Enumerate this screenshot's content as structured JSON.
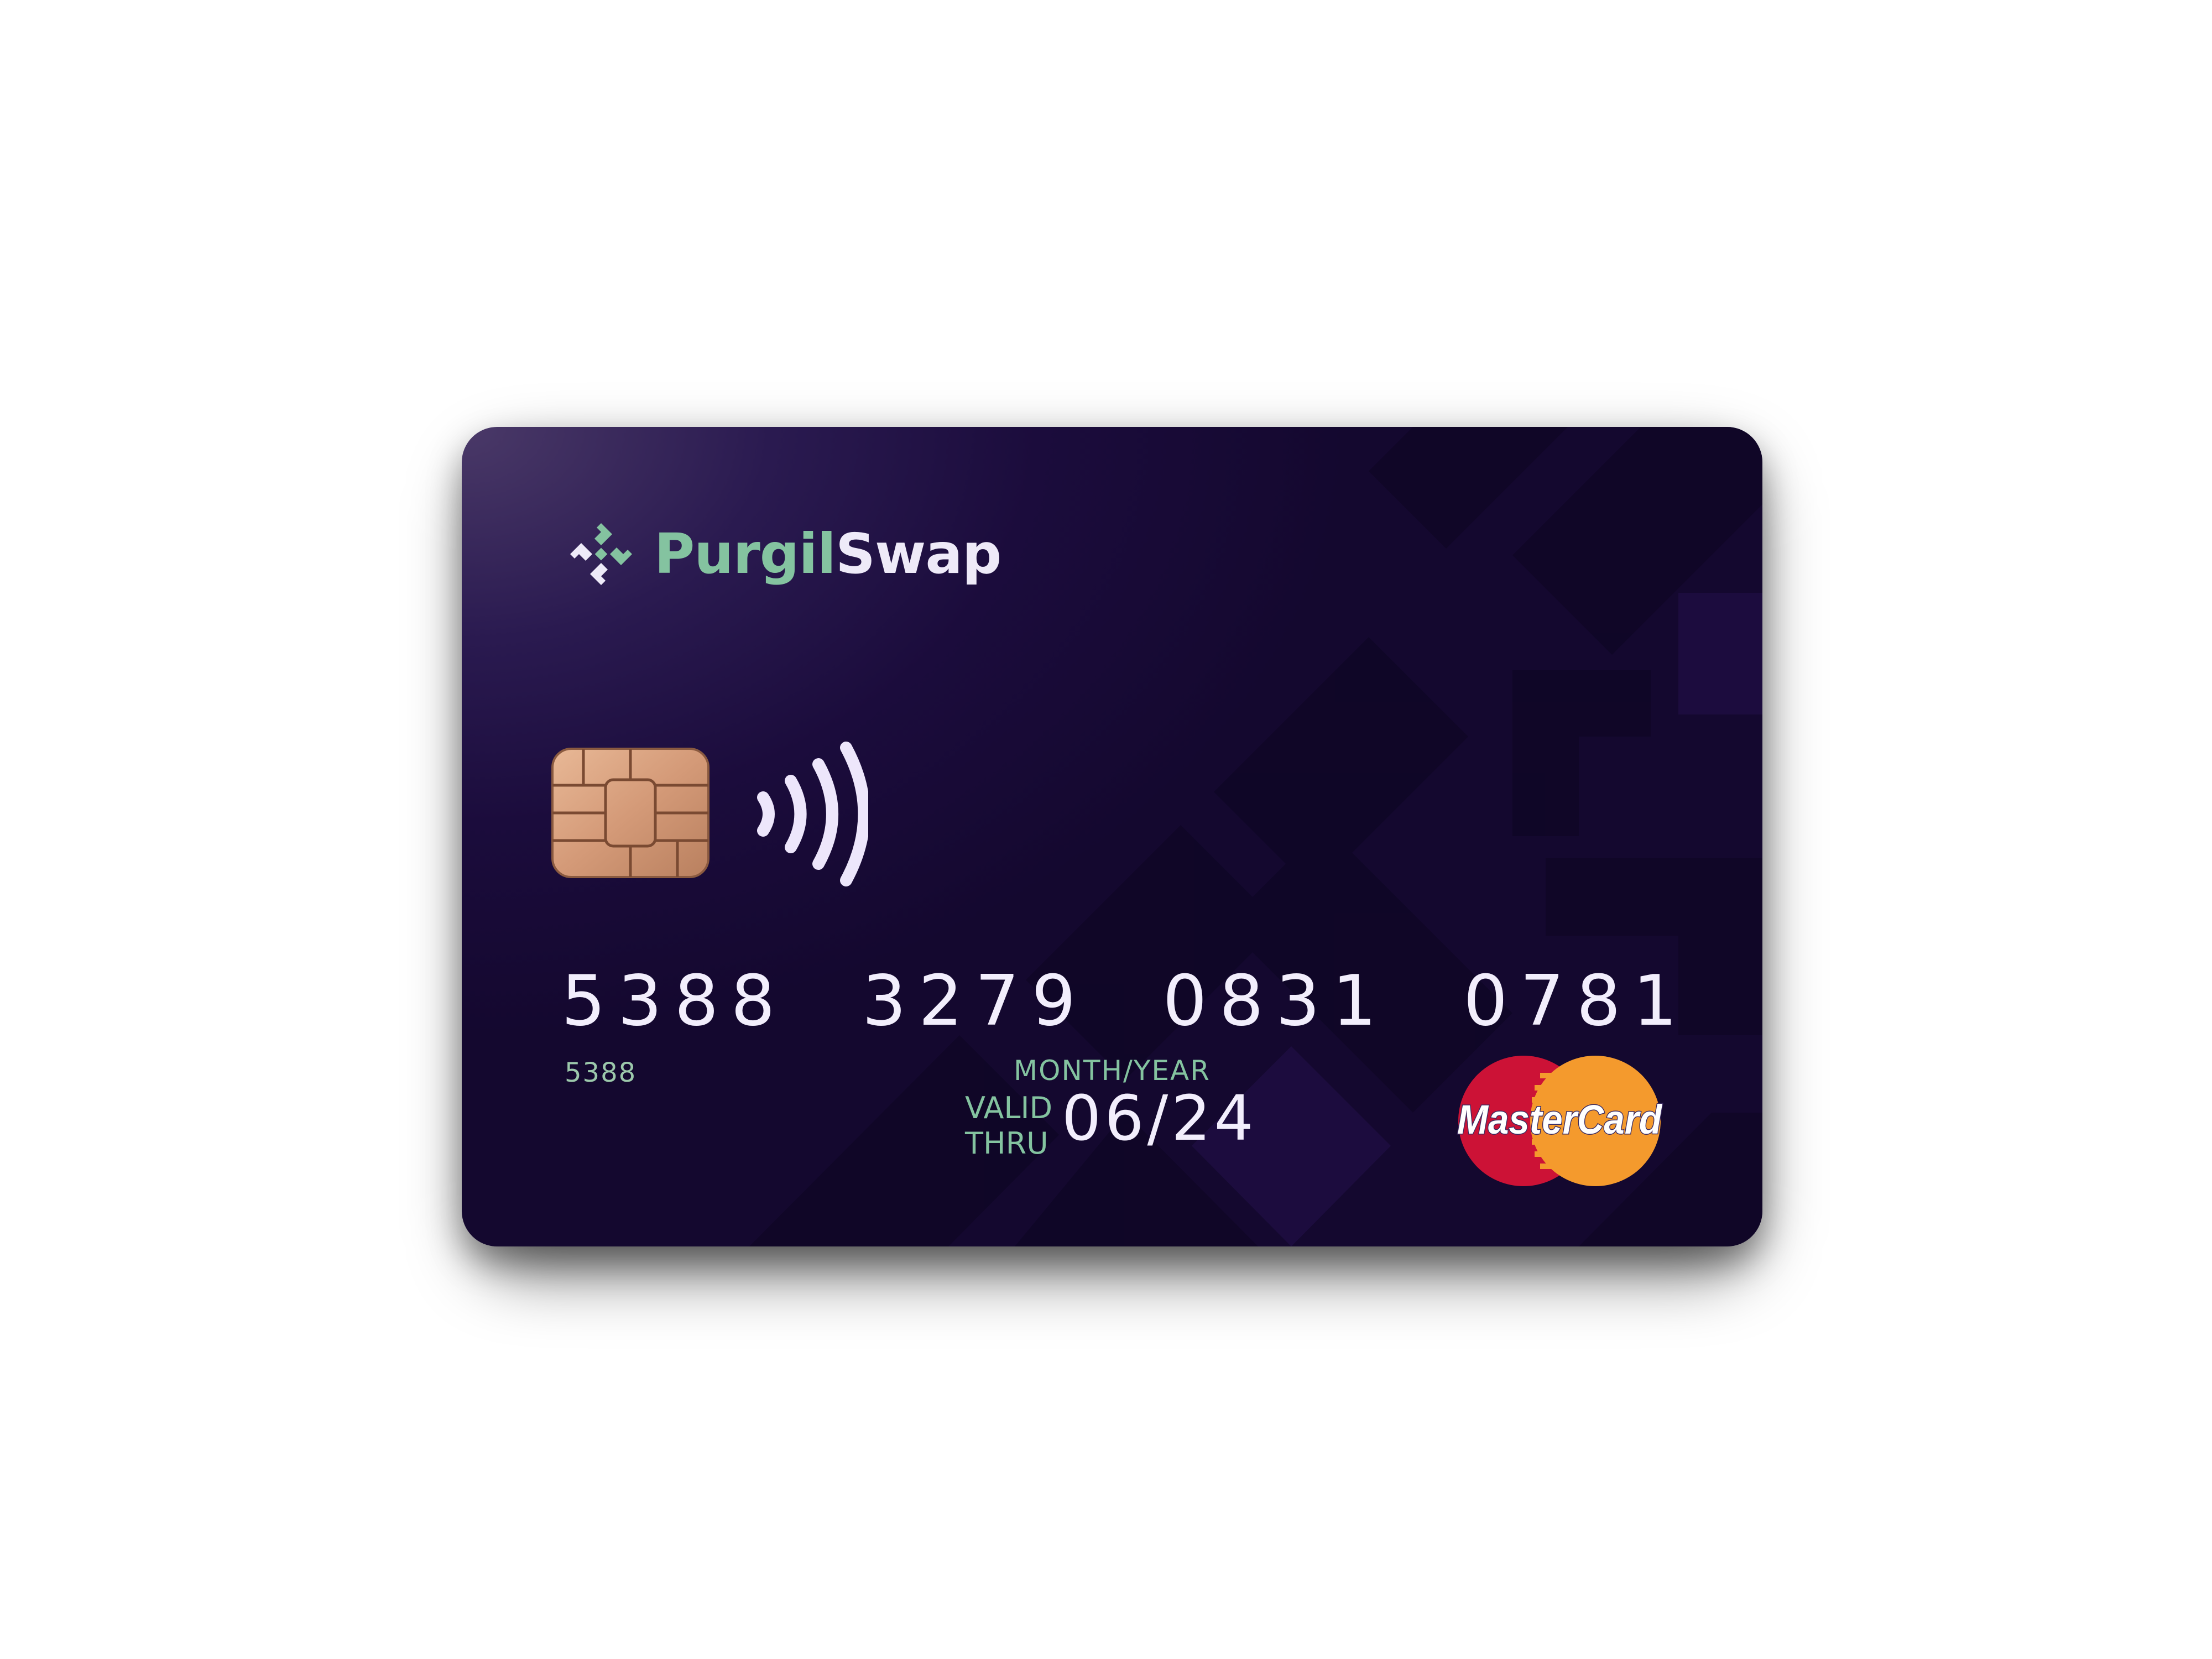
{
  "card": {
    "brand_part1": "Purgil",
    "brand_part2": "Swap",
    "number_groups": [
      "5388",
      "3279",
      "0831",
      "0781"
    ],
    "small_number": "5388",
    "month_year_label": "MONTH/YEAR",
    "valid_label": "VALID",
    "thru_label": "THRU",
    "expiry": "06/24",
    "network_logo_text": "MasterCard"
  },
  "colors": {
    "card_background": "#1b0c3c",
    "brand_green": "#84c3a0",
    "text_light": "#f2eefc",
    "mastercard_red": "#cc1236",
    "mastercard_orange": "#f49a2d",
    "chip_gold": "#d9a585"
  },
  "icons": {
    "logo": "purgilswap-logo-icon",
    "chip": "emv-chip-icon",
    "contactless": "contactless-icon",
    "network": "mastercard-logo"
  }
}
